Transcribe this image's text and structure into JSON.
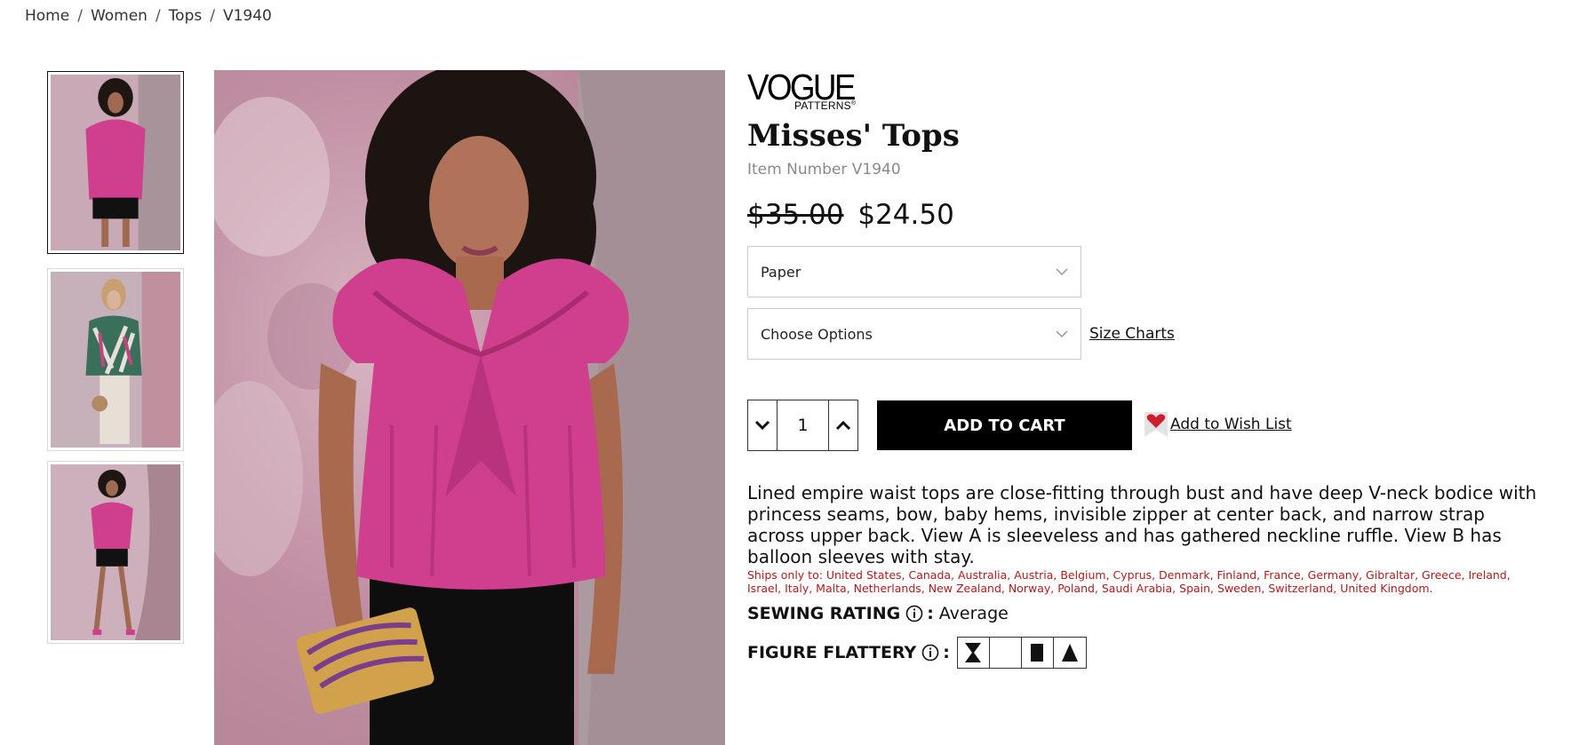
{
  "breadcrumb": {
    "items": [
      "Home",
      "Women",
      "Tops",
      "V1940"
    ],
    "separator": "/"
  },
  "brand": {
    "line1": "VOGUE",
    "line2": "PATTERNS",
    "reg_mark": "®"
  },
  "product": {
    "title": "Misses' Tops",
    "item_number": "Item Number V1940",
    "price_old": "$35.00",
    "price_new": "$24.50",
    "format_select": "Paper",
    "options_select": "Choose Options",
    "size_charts": "Size Charts",
    "quantity": "1",
    "add_to_cart": "ADD TO CART",
    "wish_list": "Add to Wish List",
    "description": "Lined empire waist tops are close-fitting through bust and have deep V-neck bodice with princess seams, bow, baby hems, invisible zipper at center back, and narrow strap across upper back. View A is sleeveless and has gathered neckline ruffle. View B has balloon sleeves with stay.",
    "ships_only_to": "Ships only to: United States, Canada, Australia, Austria, Belgium, Cyprus, Denmark, Finland, France, Germany, Gibraltar, Greece, Ireland, Israel, Italy, Malta, Netherlands, New Zealand, Norway, Poland, Saudi Arabia, Spain, Sweden, Switzerland, United Kingdom.",
    "sewing_rating_label": "SEWING RATING",
    "sewing_rating_value": "Average",
    "figure_flattery_label": "FIGURE FLATTERY",
    "colon": ":",
    "figure_shapes": [
      "hourglass-icon",
      "blank",
      "rectangle-icon",
      "triangle-icon"
    ]
  },
  "colors": {
    "accent": "#000000",
    "ships_text": "#b31b1b",
    "heart": "#cc1f2e",
    "blouse": "#cf3f8e"
  }
}
